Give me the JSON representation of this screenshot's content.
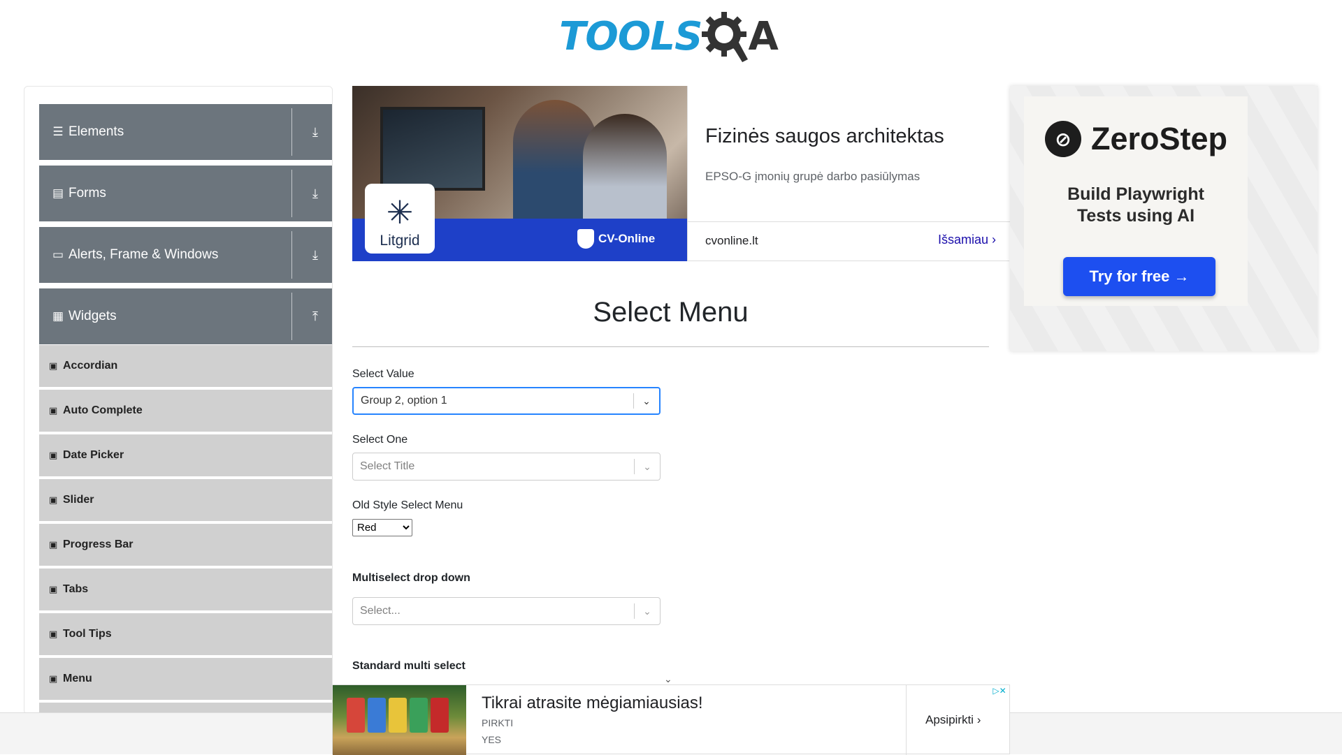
{
  "logo": {
    "text_tools": "TOOLS",
    "text_qa": "A"
  },
  "sidebar": {
    "groups": [
      {
        "label": "Elements",
        "icon": "hamburger-icon",
        "toggle": "⤓"
      },
      {
        "label": "Forms",
        "icon": "document-icon",
        "toggle": "⤓"
      },
      {
        "label": "Alerts, Frame & Windows",
        "icon": "window-icon",
        "toggle": "⤓"
      },
      {
        "label": "Widgets",
        "icon": "grid-icon",
        "toggle": "⤒"
      }
    ],
    "items": [
      {
        "label": "Accordian"
      },
      {
        "label": "Auto Complete"
      },
      {
        "label": "Date Picker"
      },
      {
        "label": "Slider"
      },
      {
        "label": "Progress Bar"
      },
      {
        "label": "Tabs"
      },
      {
        "label": "Tool Tips"
      },
      {
        "label": "Menu"
      }
    ]
  },
  "ad_top": {
    "brand_litgrid": "Litgrid",
    "brand_cvonline": "CV-Online",
    "title": "Fizinės saugos architektas",
    "subtitle": "EPSO-G įmonių grupė darbo pasiūlymas",
    "domain": "cvonline.lt",
    "cta": "Išsamiau"
  },
  "ad_right": {
    "brand": "ZeroStep",
    "tagline_line1": "Build Playwright",
    "tagline_line2": "Tests using AI",
    "button": "Try for free →"
  },
  "main": {
    "title": "Select Menu",
    "select_value": {
      "label": "Select Value",
      "value": "Group 2, option 1"
    },
    "select_one": {
      "label": "Select One",
      "placeholder": "Select Title"
    },
    "old_style": {
      "label": "Old Style Select Menu",
      "value": "Red"
    },
    "multiselect": {
      "label": "Multiselect drop down",
      "placeholder": "Select..."
    },
    "standard_multi": {
      "label": "Standard multi select"
    }
  },
  "ad_bottom": {
    "title": "Tikrai atrasite mėgiamiausias!",
    "line1": "PIRKTI",
    "line2": "YES",
    "cta": "Apsipirkti",
    "adchoices": "▷✕"
  },
  "colors": {
    "sidebar_group": "#6c757d",
    "sidebar_item": "#d0d0d0",
    "focus_border": "#2684ff",
    "zerostep_button": "#1d4ff0",
    "ad_blue": "#1e40c8",
    "logo_blue": "#1c9ad6"
  }
}
